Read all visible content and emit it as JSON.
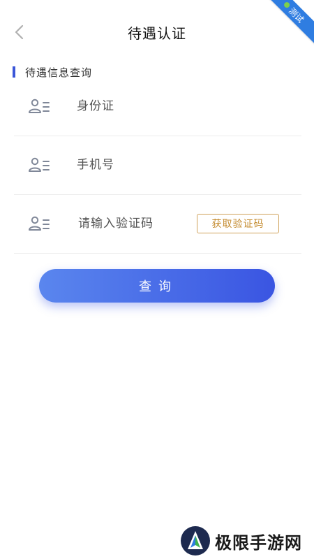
{
  "header": {
    "title": "待遇认证",
    "back_icon": "chevron-left-icon"
  },
  "ribbon": {
    "label": "测试",
    "color": "#2f7de1"
  },
  "section": {
    "title": "待遇信息查询",
    "accent_color": "#3b56d8"
  },
  "form": {
    "id_card": {
      "placeholder": "身份证",
      "value": ""
    },
    "phone": {
      "placeholder": "手机号",
      "value": ""
    },
    "code": {
      "placeholder": "请输入验证码",
      "value": "",
      "button_label": "获取验证码"
    },
    "row_icon": "user-list-icon"
  },
  "actions": {
    "query_label": "查询",
    "query_colors": [
      "#5a86ee",
      "#3a55e2"
    ]
  },
  "watermark": {
    "text": "极限手游网"
  }
}
